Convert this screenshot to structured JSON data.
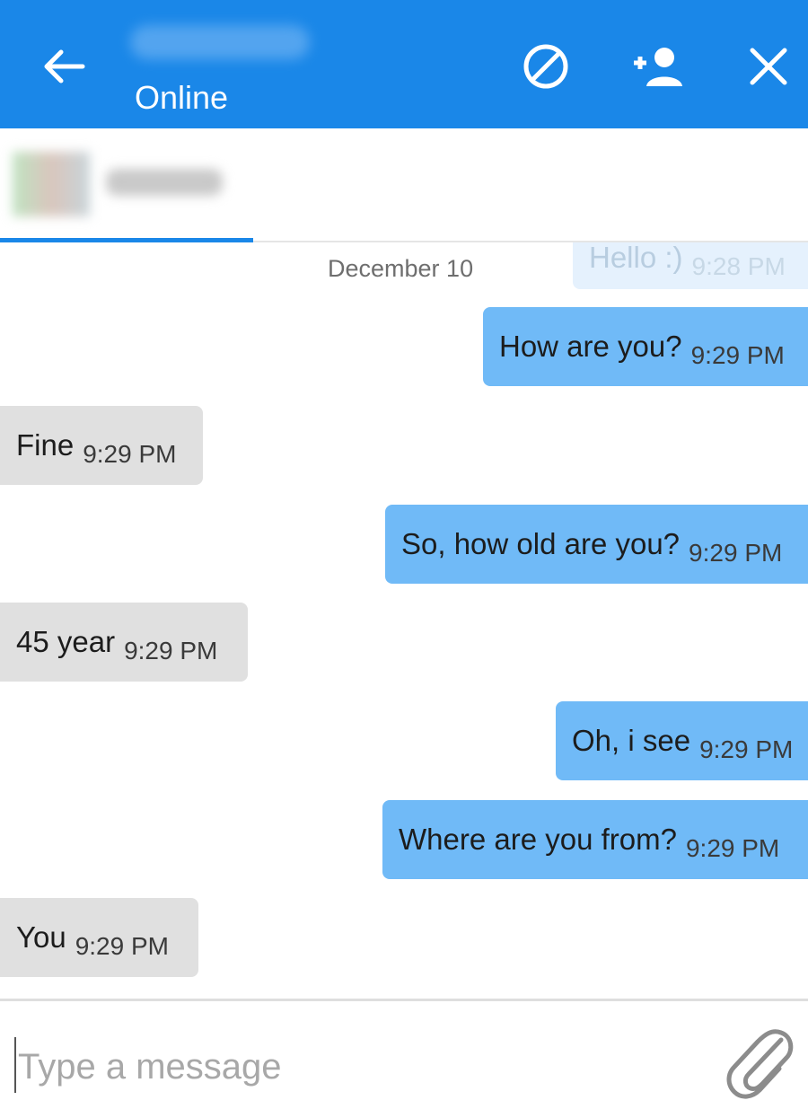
{
  "header": {
    "status": "Online",
    "icons": [
      "back-arrow-icon",
      "block-icon",
      "add-person-icon",
      "close-icon"
    ]
  },
  "chat": {
    "date": "December 10",
    "messages": [
      {
        "dir": "out",
        "text": "Hello :)",
        "time": "9:28 PM",
        "faded": true
      },
      {
        "dir": "out",
        "text": "How are you?",
        "time": "9:29 PM"
      },
      {
        "dir": "in",
        "text": "Fine",
        "time": "9:29 PM"
      },
      {
        "dir": "out",
        "text": "So, how old are you?",
        "time": "9:29 PM"
      },
      {
        "dir": "in",
        "text": "45 year",
        "time": "9:29 PM"
      },
      {
        "dir": "out",
        "text": "Oh, i see",
        "time": "9:29 PM"
      },
      {
        "dir": "out",
        "text": "Where are you from?",
        "time": "9:29 PM"
      },
      {
        "dir": "in",
        "text": "You",
        "time": "9:29 PM"
      }
    ]
  },
  "composer": {
    "placeholder": "Type a message",
    "attach_icon": "paperclip-icon"
  },
  "colors": {
    "header": "#1a87e8",
    "outgoing_bubble": "#70baf7",
    "incoming_bubble": "#e0e0e0"
  }
}
